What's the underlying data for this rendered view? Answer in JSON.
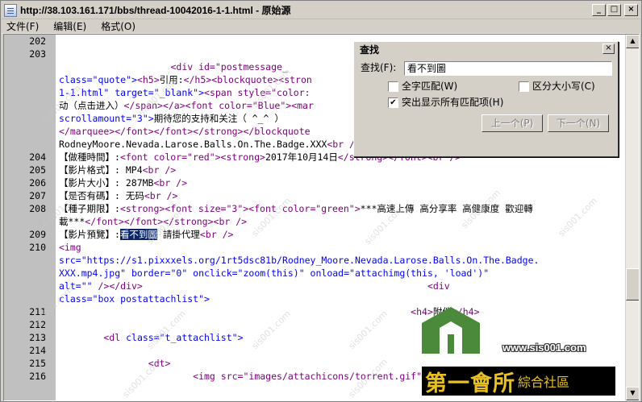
{
  "window": {
    "title": "http://38.103.161.171/bbs/thread-10042016-1-1.html - 原始源",
    "buttons": {
      "minimize": "_",
      "maximize": "□",
      "close": "×"
    }
  },
  "menu": [
    "文件(F)",
    "编辑(E)",
    "格式(O)"
  ],
  "lines": [
    {
      "n": "202",
      "parts": []
    },
    {
      "n": "203",
      "parts": []
    },
    {
      "n": "",
      "parts": [
        {
          "c": "tag",
          "t": "                    <div id=\"postmessage_"
        }
      ]
    },
    {
      "n": "",
      "parts": [
        {
          "c": "val",
          "t": "class=\"quote\">"
        },
        {
          "c": "tag",
          "t": "<h5>"
        },
        {
          "c": "txt",
          "t": "引用:"
        },
        {
          "c": "tag",
          "t": "</h5><blockquote><stron"
        }
      ]
    },
    {
      "n": "",
      "parts": [
        {
          "c": "val",
          "t": "1-1.html\" target=\"_blank\">"
        },
        {
          "c": "tag",
          "t": "<span style=\"color:"
        }
      ]
    },
    {
      "n": "",
      "parts": [
        {
          "c": "txt",
          "t": "动（点击进入）"
        },
        {
          "c": "tag",
          "t": "</span></a><font color=\"Blue\"><mar"
        }
      ]
    },
    {
      "n": "",
      "parts": [
        {
          "c": "val",
          "t": "scrollamount=\"3\">"
        },
        {
          "c": "txt",
          "t": "期待您的支持和关注（ ^_^ ）"
        }
      ]
    },
    {
      "n": "",
      "parts": [
        {
          "c": "tag",
          "t": "</marquee></font></font></strong></blockquote"
        }
      ]
    },
    {
      "n": "",
      "parts": [
        {
          "c": "txt",
          "t": "RodneyMoore.Nevada.Larose.Balls.On.The.Badge.XXX"
        },
        {
          "c": "tag",
          "t": "<br />"
        }
      ]
    },
    {
      "n": "204",
      "parts": [
        {
          "c": "txt",
          "t": "【做種時間】:"
        },
        {
          "c": "tag",
          "t": "<font color=\"red\"><strong>"
        },
        {
          "c": "txt",
          "t": "2017年10月14日"
        },
        {
          "c": "tag",
          "t": "</strong></font><br />"
        }
      ]
    },
    {
      "n": "205",
      "parts": [
        {
          "c": "txt",
          "t": "【影片格式】: MP4"
        },
        {
          "c": "tag",
          "t": "<br />"
        }
      ]
    },
    {
      "n": "206",
      "parts": [
        {
          "c": "txt",
          "t": "【影片大小】: 287MB"
        },
        {
          "c": "tag",
          "t": "<br />"
        }
      ]
    },
    {
      "n": "207",
      "parts": [
        {
          "c": "txt",
          "t": "【是否有碼】: 无码"
        },
        {
          "c": "tag",
          "t": "<br />"
        }
      ]
    },
    {
      "n": "208",
      "parts": [
        {
          "c": "txt",
          "t": "【種子期限】:"
        },
        {
          "c": "tag",
          "t": "<strong><font size=\"3\"><font color=\"green\">"
        },
        {
          "c": "txt",
          "t": "***高速上傳 高分享率 高健康度 歡迎轉"
        }
      ]
    },
    {
      "n": "",
      "parts": [
        {
          "c": "txt",
          "t": "載***"
        },
        {
          "c": "tag",
          "t": "</font></font></strong><br />"
        }
      ]
    },
    {
      "n": "209",
      "parts": [
        {
          "c": "txt",
          "t": "【影片預覽】:"
        },
        {
          "c": "hl",
          "t": "看不到圖"
        },
        {
          "c": "txt",
          "t": " 請掛代理"
        },
        {
          "c": "tag",
          "t": "<br />"
        }
      ]
    },
    {
      "n": "210",
      "parts": [
        {
          "c": "tag",
          "t": "<img"
        }
      ]
    },
    {
      "n": "",
      "parts": [
        {
          "c": "val",
          "t": "src=\"https://s1.pixxxels.org/1rt5dsc81b/Rodney_Moore.Nevada.Larose.Balls.On.The.Badge."
        }
      ]
    },
    {
      "n": "",
      "parts": [
        {
          "c": "val",
          "t": "XXX.mp4.jpg\" border=\"0\" onclick=\"zoom(this)\" onload=\"attachimg(this, 'load')\""
        }
      ]
    },
    {
      "n": "",
      "parts": [
        {
          "c": "val",
          "t": "alt=\"\" "
        },
        {
          "c": "tag",
          "t": "/></div>                                                   <div"
        }
      ]
    },
    {
      "n": "",
      "parts": [
        {
          "c": "val",
          "t": "class=\"box postattachlist\">"
        }
      ]
    },
    {
      "n": "211",
      "parts": [
        {
          "c": "tag",
          "t": "                                                               <h4>"
        },
        {
          "c": "txt",
          "t": "附件"
        },
        {
          "c": "tag",
          "t": "</h4>"
        }
      ]
    },
    {
      "n": "212",
      "parts": []
    },
    {
      "n": "213",
      "parts": [
        {
          "c": "tag",
          "t": "        <dl "
        },
        {
          "c": "val",
          "t": "class=\"t_attachlist\">"
        }
      ]
    },
    {
      "n": "214",
      "parts": []
    },
    {
      "n": "215",
      "parts": [
        {
          "c": "tag",
          "t": "                <dt>"
        }
      ]
    },
    {
      "n": "216",
      "parts": [
        {
          "c": "tag",
          "t": "                        <img src=\"images/attachicons/torrent.gif\" border=\"0\""
        }
      ]
    }
  ],
  "find": {
    "title": "查找",
    "label": "查找(F):",
    "value": "看不到圖",
    "whole_word": "全字匹配(W)",
    "match_case": "区分大小写(C)",
    "highlight_all": "突出显示所有匹配项(H)",
    "prev": "上一个(P)",
    "next": "下一个(N)",
    "close": "×",
    "whole_word_checked": false,
    "match_case_checked": false,
    "highlight_all_checked": true
  },
  "watermark": {
    "url": "www.sis001.com",
    "brand_main": "第一會所",
    "brand_sub": "綜合社區",
    "repeat": "sis001.com",
    "logo_color": "#4a8a3a"
  }
}
